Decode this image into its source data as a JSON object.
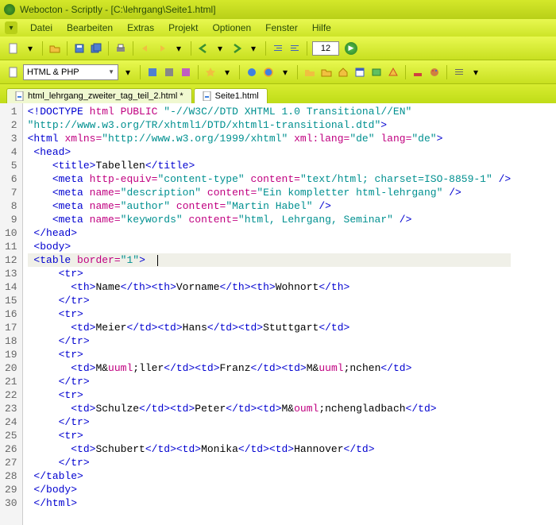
{
  "title": "Webocton - Scriptly - [C:\\lehrgang\\Seite1.html]",
  "menu": [
    "Datei",
    "Bearbeiten",
    "Extras",
    "Projekt",
    "Optionen",
    "Fenster",
    "Hilfe"
  ],
  "toolbar": {
    "page_num": "12"
  },
  "lang_select": "HTML & PHP",
  "tabs": [
    {
      "label": "html_lehrgang_zweiter_tag_teil_2.html *",
      "active": false
    },
    {
      "label": "Seite1.html",
      "active": true
    }
  ],
  "code_lines": [
    {
      "n": 1,
      "html": "<span class='kw'>&lt;!DOCTYPE</span> <span class='attr'>html PUBLIC</span> <span class='str'>\"-//W3C//DTD XHTML 1.0 Transitional//EN\"</span>"
    },
    {
      "n": 2,
      "html": "<span class='str'>\"http://www.w3.org/TR/xhtml1/DTD/xhtml1-transitional.dtd\"</span><span class='kw'>&gt;</span>"
    },
    {
      "n": 3,
      "html": "<span class='kw'>&lt;html</span> <span class='attr'>xmlns=</span><span class='str'>\"http://www.w3.org/1999/xhtml\"</span> <span class='attr'>xml:lang=</span><span class='str'>\"de\"</span> <span class='attr'>lang=</span><span class='str'>\"de\"</span><span class='kw'>&gt;</span>"
    },
    {
      "n": 4,
      "html": " <span class='kw'>&lt;head&gt;</span>"
    },
    {
      "n": 5,
      "html": "    <span class='kw'>&lt;title&gt;</span><span class='txt'>Tabellen</span><span class='kw'>&lt;/title&gt;</span>"
    },
    {
      "n": 6,
      "html": "    <span class='kw'>&lt;meta</span> <span class='attr'>http-equiv=</span><span class='str'>\"content-type\"</span> <span class='attr'>content=</span><span class='str'>\"text/html; charset=ISO-8859-1\"</span> <span class='kw'>/&gt;</span>"
    },
    {
      "n": 7,
      "html": "    <span class='kw'>&lt;meta</span> <span class='attr'>name=</span><span class='str'>\"description\"</span> <span class='attr'>content=</span><span class='str'>\"Ein kompletter html-lehrgang\"</span> <span class='kw'>/&gt;</span>"
    },
    {
      "n": 8,
      "html": "    <span class='kw'>&lt;meta</span> <span class='attr'>name=</span><span class='str'>\"author\"</span> <span class='attr'>content=</span><span class='str'>\"Martin Habel\"</span> <span class='kw'>/&gt;</span>"
    },
    {
      "n": 9,
      "html": "    <span class='kw'>&lt;meta</span> <span class='attr'>name=</span><span class='str'>\"keywords\"</span> <span class='attr'>content=</span><span class='str'>\"html, Lehrgang, Seminar\"</span> <span class='kw'>/&gt;</span>"
    },
    {
      "n": 10,
      "html": " <span class='kw'>&lt;/head&gt;</span>"
    },
    {
      "n": 11,
      "html": " <span class='kw'>&lt;body&gt;</span>"
    },
    {
      "n": 12,
      "hlt": true,
      "html": " <span class='kw'>&lt;table</span> <span class='attr'>border=</span><span class='str'>\"1\"</span><span class='kw'>&gt;</span>  <span class='cursor'></span>"
    },
    {
      "n": 13,
      "html": "     <span class='kw'>&lt;tr&gt;</span>"
    },
    {
      "n": 14,
      "html": "       <span class='kw'>&lt;th&gt;</span><span class='txt'>Name</span><span class='kw'>&lt;/th&gt;&lt;th&gt;</span><span class='txt'>Vorname</span><span class='kw'>&lt;/th&gt;&lt;th&gt;</span><span class='txt'>Wohnort</span><span class='kw'>&lt;/th&gt;</span>"
    },
    {
      "n": 15,
      "html": "     <span class='kw'>&lt;/tr&gt;</span>"
    },
    {
      "n": 16,
      "html": "     <span class='kw'>&lt;tr&gt;</span>"
    },
    {
      "n": 17,
      "html": "       <span class='kw'>&lt;td&gt;</span><span class='txt'>Meier</span><span class='kw'>&lt;/td&gt;&lt;td&gt;</span><span class='txt'>Hans</span><span class='kw'>&lt;/td&gt;&lt;td&gt;</span><span class='txt'>Stuttgart</span><span class='kw'>&lt;/td&gt;</span>"
    },
    {
      "n": 18,
      "html": "     <span class='kw'>&lt;/tr&gt;</span>"
    },
    {
      "n": 19,
      "html": "     <span class='kw'>&lt;tr&gt;</span>"
    },
    {
      "n": 20,
      "html": "       <span class='kw'>&lt;td&gt;</span><span class='txt'>M&amp;</span><span class='attr'>uuml</span><span class='txt'>;ller</span><span class='kw'>&lt;/td&gt;&lt;td&gt;</span><span class='txt'>Franz</span><span class='kw'>&lt;/td&gt;&lt;td&gt;</span><span class='txt'>M&amp;</span><span class='attr'>uuml</span><span class='txt'>;nchen</span><span class='kw'>&lt;/td&gt;</span>"
    },
    {
      "n": 21,
      "html": "     <span class='kw'>&lt;/tr&gt;</span>"
    },
    {
      "n": 22,
      "html": "     <span class='kw'>&lt;tr&gt;</span>"
    },
    {
      "n": 23,
      "html": "       <span class='kw'>&lt;td&gt;</span><span class='txt'>Schulze</span><span class='kw'>&lt;/td&gt;&lt;td&gt;</span><span class='txt'>Peter</span><span class='kw'>&lt;/td&gt;&lt;td&gt;</span><span class='txt'>M&amp;</span><span class='attr'>ouml</span><span class='txt'>;nchengladbach</span><span class='kw'>&lt;/td&gt;</span>"
    },
    {
      "n": 24,
      "html": "     <span class='kw'>&lt;/tr&gt;</span>"
    },
    {
      "n": 25,
      "html": "     <span class='kw'>&lt;tr&gt;</span>"
    },
    {
      "n": 26,
      "html": "       <span class='kw'>&lt;td&gt;</span><span class='txt'>Schubert</span><span class='kw'>&lt;/td&gt;&lt;td&gt;</span><span class='txt'>Monika</span><span class='kw'>&lt;/td&gt;&lt;td&gt;</span><span class='txt'>Hannover</span><span class='kw'>&lt;/td&gt;</span>"
    },
    {
      "n": 27,
      "html": "     <span class='kw'>&lt;/tr&gt;</span>"
    },
    {
      "n": 28,
      "html": " <span class='kw'>&lt;/table&gt;</span>"
    },
    {
      "n": 29,
      "html": " <span class='kw'>&lt;/body&gt;</span>"
    },
    {
      "n": 30,
      "html": " <span class='kw'>&lt;/html&gt;</span>"
    },
    {
      "n": "",
      "blank": true,
      "html": ""
    }
  ]
}
